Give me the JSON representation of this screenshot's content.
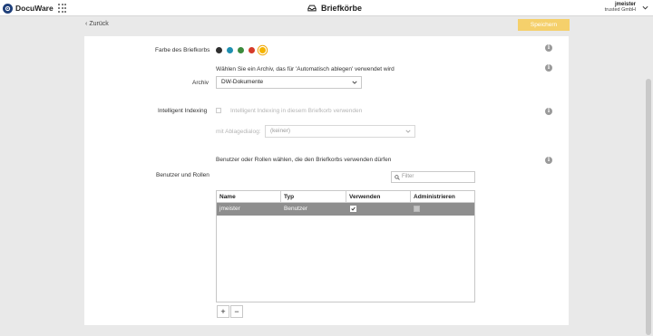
{
  "header": {
    "logo_text": "DocuWare",
    "title": "Briefkörbe",
    "user_name": "jmeister",
    "user_org": "trusted GmbH"
  },
  "subheader": {
    "back_label": "Zurück",
    "save_label": "Speichern"
  },
  "form": {
    "color_label": "Farbe des Briefkorbs",
    "colors": [
      "#2f2f2f",
      "#1f8fb0",
      "#3c8b3c",
      "#d43a2a",
      "#f5b400"
    ],
    "selected_color_index": 4,
    "archive_hint": "Wählen Sie ein Archiv, das für 'Automatisch ablegen' verwendet wird",
    "archive_label": "Archiv",
    "archive_value": "DW-Dokumente",
    "indexing_label": "Intelligent Indexing",
    "indexing_checkbox_label": "Intelligent Indexing in diesem Briefkorb verwenden",
    "dialog_label": "mit Ablagedialog:",
    "dialog_value": "(keiner)",
    "users_hint": "Benutzer oder Rollen wählen, die den Briefkorbs verwenden dürfen",
    "users_label": "Benutzer und Rollen",
    "filter_placeholder": "Filter"
  },
  "table": {
    "columns": [
      "Name",
      "Typ",
      "Verwenden",
      "Administrieren"
    ],
    "rows": [
      {
        "name": "jmeister",
        "type": "Benutzer",
        "use": true,
        "admin": false
      }
    ]
  },
  "table_buttons": {
    "add": "+",
    "remove": "−"
  },
  "info_glyph": "i"
}
